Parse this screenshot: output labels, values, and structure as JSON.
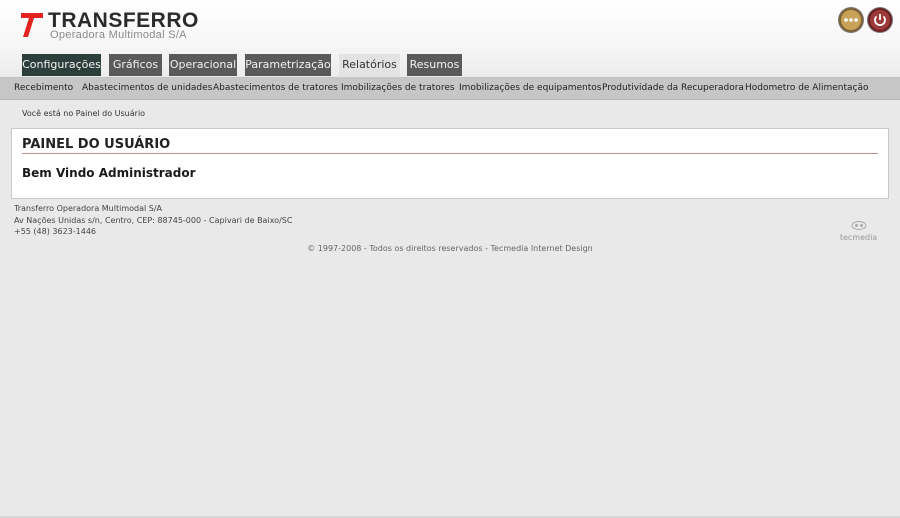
{
  "brand": {
    "name": "TRANSFERRO",
    "subtitle": "Operadora Multimodal S/A",
    "accent_color": "#e2241f"
  },
  "header_icons": [
    {
      "name": "more-icon",
      "color": "#c9a25a"
    },
    {
      "name": "power-icon",
      "color": "#9b3b3b"
    }
  ],
  "tabs": [
    {
      "label": "Configurações",
      "state": "dark"
    },
    {
      "label": "Gráficos",
      "state": "normal"
    },
    {
      "label": "Operacional",
      "state": "normal"
    },
    {
      "label": "Parametrização",
      "state": "normal"
    },
    {
      "label": "Relatórios",
      "state": "active"
    },
    {
      "label": "Resumos",
      "state": "normal"
    }
  ],
  "subnav": [
    "Recebimento",
    "Abastecimentos de unidades",
    "Abastecimentos de tratores",
    "Imobilizações de tratores",
    "Imobilizações de equipamentos",
    "Produtividade da Recuperadora",
    "Hodometro de Alimentação"
  ],
  "breadcrumb": "Você está no Painel do Usuário",
  "panel": {
    "title": "PAINEL DO USUÁRIO",
    "welcome": "Bem Vindo Administrador"
  },
  "footer": {
    "company": "Transferro Operadora Multimodal S/A",
    "address": "Av Nações Unidas s/n, Centro, CEP: 88745-000 - Capivari de Baixo/SC",
    "phone": "+55 (48) 3623-1446",
    "copyright": "© 1997-2008 - Todos os direitos reservados - Tecmedia Internet Design",
    "tecmedia": "tecmedia"
  }
}
